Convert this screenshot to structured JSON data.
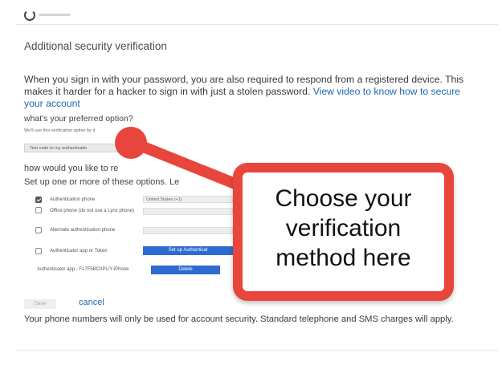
{
  "page": {
    "title": "Additional security verification",
    "intro_text": "When you sign in with your password, you are also required to respond from a registered device. This makes it harder for a hacker to sign in with just a stolen password.",
    "intro_link": "View video to know how to secure your account",
    "preferred_question": "what's your preferred option?",
    "preferred_note": "We'll use this verification option by d",
    "preferred_select_value": "Text code to my authenticatio",
    "respond_question": "how would you like to re",
    "setup_question": "Set up one or more of these options. Le",
    "options": [
      {
        "label": "Authentication phone",
        "checked": true,
        "field_value": "United States (+1)"
      },
      {
        "label": "Office phone (do not use a Lync phone)",
        "checked": false
      },
      {
        "label": "Alternate authentication phone",
        "checked": false
      },
      {
        "label": "Authenticator app or Token",
        "checked": false,
        "button_label": "Set up Authenticat"
      }
    ],
    "authenticator_app_label": "Authenticator app - F17F5BC0PL/Y-iPhone",
    "delete_button_label": "Delete",
    "save_label": "Save",
    "cancel_label": "cancel",
    "footer_text": "Your phone numbers will only be used for account security. Standard telephone and SMS charges will apply."
  },
  "annotation": {
    "callout_text": "Choose your verification method here",
    "callout_color": "#e8453c"
  },
  "colors": {
    "link": "#1f67b1",
    "button_blue": "#2d6bd0"
  }
}
